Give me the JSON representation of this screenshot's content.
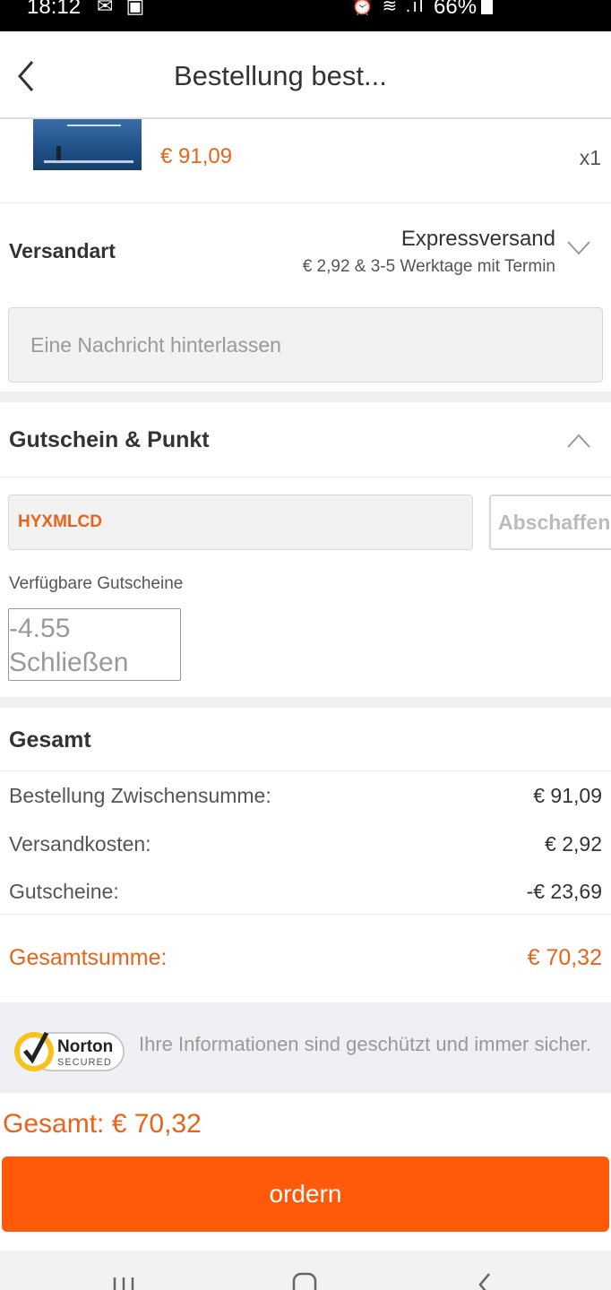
{
  "status_bar": {
    "time": "18:12",
    "notification_icons": "✉ ▣",
    "system_icons": "⏰ ≋ .ıl",
    "battery_percent": "66%"
  },
  "header": {
    "title": "Bestellung best..."
  },
  "product": {
    "price": "€ 91,09",
    "quantity": "x1"
  },
  "shipping": {
    "label": "Versandart",
    "method": "Expressversand",
    "detail": "€ 2,92 & 3-5 Werktage mit Termin"
  },
  "message": {
    "placeholder": "Eine Nachricht hinterlassen"
  },
  "coupon": {
    "title": "Gutschein & Punkt",
    "code": "HYXMLCD",
    "cancel_label": "Abschaffen",
    "available_label": "Verfügbare Gutscheine",
    "voucher_amount": "-4.55",
    "voucher_action": "Schließen"
  },
  "totals": {
    "title": "Gesamt",
    "rows": [
      {
        "label": "Bestellung Zwischensumme:",
        "value": "€ 91,09"
      },
      {
        "label": "Versandkosten:",
        "value": "€ 2,92"
      },
      {
        "label": "Gutscheine:",
        "value": "-€ 23,69"
      }
    ],
    "grand_label": "Gesamtsumme:",
    "grand_value": "€ 70,32"
  },
  "security": {
    "logo_brand": "Norton",
    "logo_sub": "SECURED",
    "text": "Ihre Informationen sind geschützt und immer sicher."
  },
  "footer": {
    "total": "Gesamt: € 70,32",
    "order_label": "ordern"
  },
  "colors": {
    "accent": "#e9631a",
    "button": "#ff5a0a"
  }
}
